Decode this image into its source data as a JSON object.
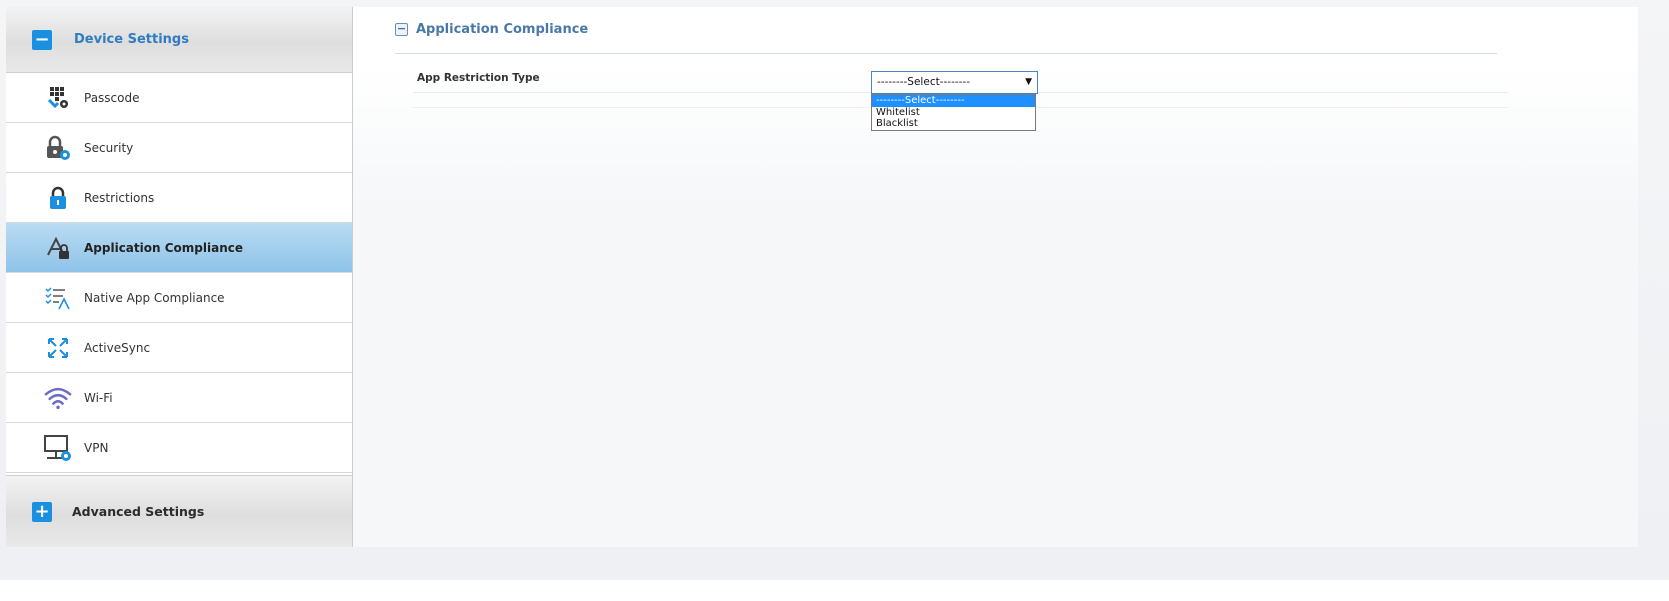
{
  "sidebar": {
    "device_settings": {
      "toggle": "−",
      "label": "Device Settings"
    },
    "advanced_settings": {
      "toggle": "+",
      "label": "Advanced Settings"
    },
    "items": [
      {
        "label": "Passcode",
        "icon": "passcode-icon"
      },
      {
        "label": "Security",
        "icon": "security-icon"
      },
      {
        "label": "Restrictions",
        "icon": "lock-icon"
      },
      {
        "label": "Application Compliance",
        "icon": "app-compliance-icon",
        "active": true
      },
      {
        "label": "Native App Compliance",
        "icon": "native-app-compliance-icon"
      },
      {
        "label": "ActiveSync",
        "icon": "activesync-icon"
      },
      {
        "label": "Wi-Fi",
        "icon": "wifi-icon"
      },
      {
        "label": "VPN",
        "icon": "vpn-icon"
      }
    ]
  },
  "main": {
    "section": {
      "toggle": "−",
      "title": "Application Compliance"
    },
    "field": {
      "label": "App Restriction Type",
      "selected_value": "--------Select--------",
      "arrow": "▼",
      "options": [
        "--------Select--------",
        "Whitelist",
        "Blacklist"
      ]
    }
  },
  "colors": {
    "accent": "#1b8fe0",
    "active_item": "#8ec3e8",
    "section_title": "#4a78a8",
    "dropdown_highlight": "#1e90ff"
  }
}
